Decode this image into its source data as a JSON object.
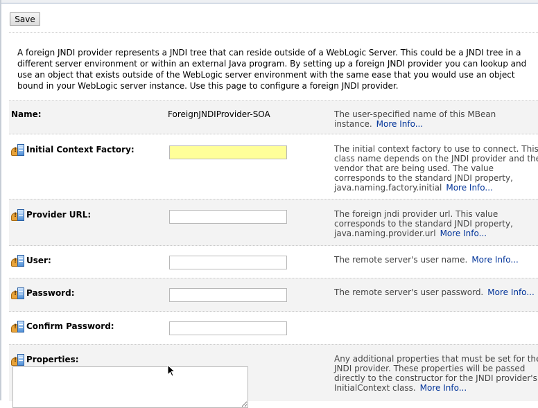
{
  "toolbar": {
    "save_label": "Save"
  },
  "intro_text": "A foreign JNDI provider represents a JNDI tree that can reside outside of a WebLogic Server. This could be a JNDI tree in a different server environment or within an external Java program. By setting up a foreign JNDI provider you can lookup and use an object that exists outside of the WebLogic server environment with the same ease that you would use an object bound in your WebLogic server instance. Use this page to configure a foreign JNDI provider.",
  "more_info_label": "More Info...",
  "colors": {
    "required_field": "#ffff99",
    "link": "#003399",
    "row_alt": "#f3f3f3"
  },
  "fields": {
    "name": {
      "label": "Name:",
      "value": "ForeignJNDIProvider-SOA",
      "description": "The user-specified name of this MBean instance."
    },
    "initial_context_factory": {
      "label": "Initial Context Factory:",
      "value": "",
      "description": "The initial context factory to use to connect. This class name depends on the JNDI provider and the vendor that are being used. The value corresponds to the standard JNDI property, java.naming.factory.initial"
    },
    "provider_url": {
      "label": "Provider URL:",
      "value": "",
      "description": "The foreign jndi provider url. This value corresponds to the standard JNDI property, java.naming.provider.url"
    },
    "user": {
      "label": "User:",
      "value": "",
      "description": "The remote server's user name."
    },
    "password": {
      "label": "Password:",
      "value": "",
      "description": "The remote server's user password."
    },
    "confirm_password": {
      "label": "Confirm Password:",
      "value": ""
    },
    "properties": {
      "label": "Properties:",
      "value": "",
      "description": "Any additional properties that must be set for the JNDI provider. These properties will be passed directly to the constructor for the JNDI provider's InitialContext class."
    }
  }
}
